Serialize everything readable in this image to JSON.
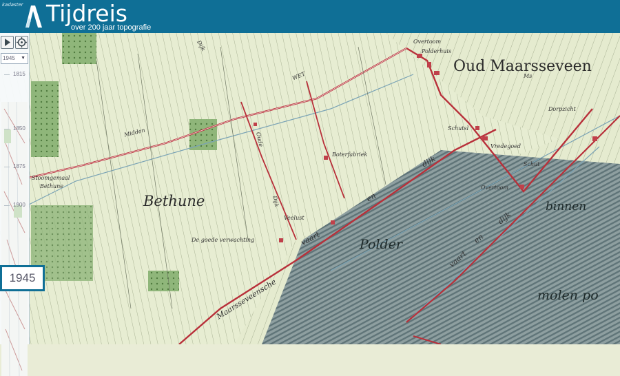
{
  "header": {
    "brand": "kadaster",
    "title": "Tijdreis",
    "subtitle": "over 200 jaar topografie"
  },
  "timeline": {
    "selected_year": "1945",
    "ticks": [
      "1815",
      "1850",
      "1875",
      "1900"
    ],
    "badge_year": "1945",
    "play_icon": "play-icon",
    "locate_icon": "locate-icon"
  },
  "map": {
    "labels": {
      "oud_maarsseveen": "Oud Maarsseveen",
      "bethune": "Bethune",
      "polder": "Polder",
      "molen_po": "molen po",
      "binnen": "binnen",
      "midden": "Midden",
      "overtoom1": "Overtoom",
      "polderhuis": "Polderhuis",
      "schutsl": "Schutsl",
      "vredegoed": "Vredegoed",
      "schut": "Schut",
      "overtoom2": "Overtoom",
      "dorpzicht": "Dorpzicht",
      "boterfabriek": "Boterfabriek",
      "veelust": "Veelust",
      "de_goede_verwachting": "De goede verwachting",
      "stoomgemaal": "Stoomgemaal",
      "bethune_small": "Bethune",
      "dijk1": "dijk",
      "dijk2": "dijk",
      "vaart1": "vaart",
      "vaart2": "vaart",
      "en1": "en",
      "en2": "en",
      "maarsseveensche": "Maarsseveensche",
      "wet": "WET",
      "oude_dijk": "Oude",
      "dijk_v": "Dijk",
      "dijk_v2": "Dijk",
      "ms": "Ms"
    }
  }
}
